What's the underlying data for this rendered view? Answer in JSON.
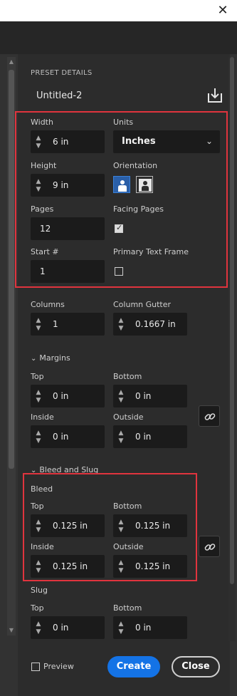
{
  "window": {
    "close_glyph": "✕"
  },
  "preset": {
    "heading": "PRESET DETAILS",
    "doc_name": "Untitled-2",
    "save_icon": "save-preset-icon"
  },
  "page": {
    "width_label": "Width",
    "width_value": "6 in",
    "units_label": "Units",
    "units_value": "Inches",
    "height_label": "Height",
    "height_value": "9 in",
    "orientation_label": "Orientation",
    "orientation_selected": "portrait",
    "pages_label": "Pages",
    "pages_value": "12",
    "facing_label": "Facing Pages",
    "facing_checked": true,
    "start_label": "Start #",
    "start_value": "1",
    "primary_label": "Primary Text Frame",
    "primary_checked": false
  },
  "columns": {
    "columns_label": "Columns",
    "columns_value": "1",
    "gutter_label": "Column Gutter",
    "gutter_value": "0.1667 in"
  },
  "margins": {
    "section_label": "Margins",
    "top_label": "Top",
    "top_value": "0 in",
    "bottom_label": "Bottom",
    "bottom_value": "0 in",
    "inside_label": "Inside",
    "inside_value": "0 in",
    "outside_label": "Outside",
    "outside_value": "0 in"
  },
  "bleed_slug": {
    "section_label": "Bleed and Slug",
    "bleed_label": "Bleed",
    "top_label": "Top",
    "top_value": "0.125 in",
    "bottom_label": "Bottom",
    "bottom_value": "0.125 in",
    "inside_label": "Inside",
    "inside_value": "0.125 in",
    "outside_label": "Outside",
    "outside_value": "0.125 in",
    "slug_label": "Slug",
    "slug_top_label": "Top",
    "slug_top_value": "0 in",
    "slug_bottom_label": "Bottom",
    "slug_bottom_value": "0 in"
  },
  "footer": {
    "preview_label": "Preview",
    "create_label": "Create",
    "close_label": "Close"
  },
  "colors": {
    "accent": "#1473e6",
    "highlight_box": "#e0343e",
    "panel_bg": "#2c2c2c",
    "field_bg": "#1b1b1b"
  }
}
